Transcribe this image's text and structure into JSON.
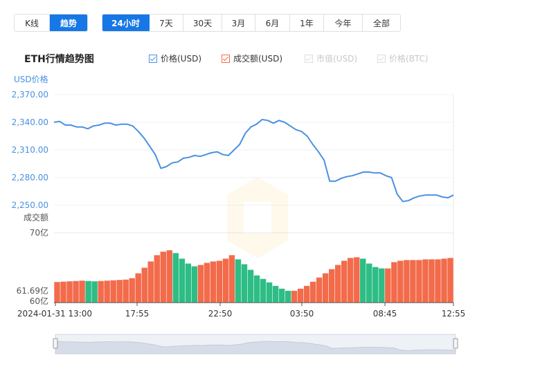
{
  "mode_tabs": [
    {
      "label": "K线",
      "active": false
    },
    {
      "label": "趋势",
      "active": true
    }
  ],
  "range_tabs": [
    {
      "label": "24小时",
      "active": true
    },
    {
      "label": "7天",
      "active": false
    },
    {
      "label": "30天",
      "active": false
    },
    {
      "label": "3月",
      "active": false
    },
    {
      "label": "6月",
      "active": false
    },
    {
      "label": "1年",
      "active": false
    },
    {
      "label": "今年",
      "active": false
    },
    {
      "label": "全部",
      "active": false
    }
  ],
  "legend": [
    {
      "label": "价格(USD)",
      "checked": true,
      "enabled": true,
      "color": "#4a90e2"
    },
    {
      "label": "成交额(USD)",
      "checked": true,
      "enabled": true,
      "color": "#f26b4b"
    },
    {
      "label": "市值(USD)",
      "checked": true,
      "enabled": false,
      "color": "#cccccc"
    },
    {
      "label": "价格(BTC)",
      "checked": true,
      "enabled": false,
      "color": "#cccccc"
    }
  ],
  "colors": {
    "accent": "#1677e6",
    "price_line": "#4a90e2",
    "volume_up": "#f26b4b",
    "volume_down": "#2dbd85",
    "navigator_fill": "#d7dde8"
  },
  "chart_data": {
    "title": "ETH行情趋势图",
    "type": "line",
    "price_axis": {
      "label": "USD价格",
      "ylim": [
        2250,
        2370
      ],
      "ticks": [
        "2,370.00",
        "2,340.00",
        "2,310.00",
        "2,280.00",
        "2,250.00"
      ]
    },
    "volume_axis": {
      "label": "成交额",
      "ylim": [
        60,
        70
      ],
      "ticks": [
        "70亿",
        "61.69亿",
        "60亿"
      ]
    },
    "x_ticks": [
      "2024-01-31 13:00",
      "17:55",
      "22:50",
      "03:50",
      "08:45",
      "12:55"
    ],
    "price_series": {
      "name": "价格(USD)",
      "values": [
        2340,
        2341,
        2337,
        2337,
        2335,
        2335,
        2333,
        2336,
        2337,
        2339,
        2339,
        2337,
        2338,
        2338,
        2336,
        2330,
        2323,
        2314,
        2305,
        2290,
        2292,
        2296,
        2297,
        2301,
        2302,
        2304,
        2303,
        2305,
        2307,
        2308,
        2305,
        2304,
        2310,
        2316,
        2328,
        2335,
        2338,
        2343,
        2342,
        2339,
        2342,
        2340,
        2336,
        2332,
        2330,
        2325,
        2316,
        2308,
        2299,
        2276,
        2276,
        2279,
        2281,
        2282,
        2284,
        2286,
        2286,
        2285,
        2285,
        2282,
        2280,
        2262,
        2254,
        2255,
        2258,
        2260,
        2261,
        2261,
        2261,
        2259,
        2258,
        2261
      ]
    },
    "volume_series": {
      "name": "成交额(USD)",
      "values": [
        62.95,
        63.0,
        63.05,
        63.1,
        63.15,
        63.1,
        63.05,
        63.1,
        63.15,
        63.2,
        63.25,
        63.3,
        63.5,
        64.2,
        65.0,
        65.9,
        66.8,
        67.3,
        67.5,
        67.1,
        66.3,
        65.6,
        65.2,
        65.4,
        65.7,
        65.9,
        66.0,
        66.3,
        66.8,
        66.2,
        65.5,
        64.7,
        63.9,
        63.4,
        62.9,
        62.4,
        62.0,
        61.7,
        61.7,
        62.0,
        62.4,
        63.0,
        63.6,
        64.2,
        64.8,
        65.4,
        66.0,
        66.4,
        66.5,
        66.3,
        65.6,
        65.1,
        64.9,
        64.9,
        65.8,
        66.0,
        66.1,
        66.1,
        66.1,
        66.2,
        66.2,
        66.2,
        66.3,
        66.4
      ]
    }
  }
}
